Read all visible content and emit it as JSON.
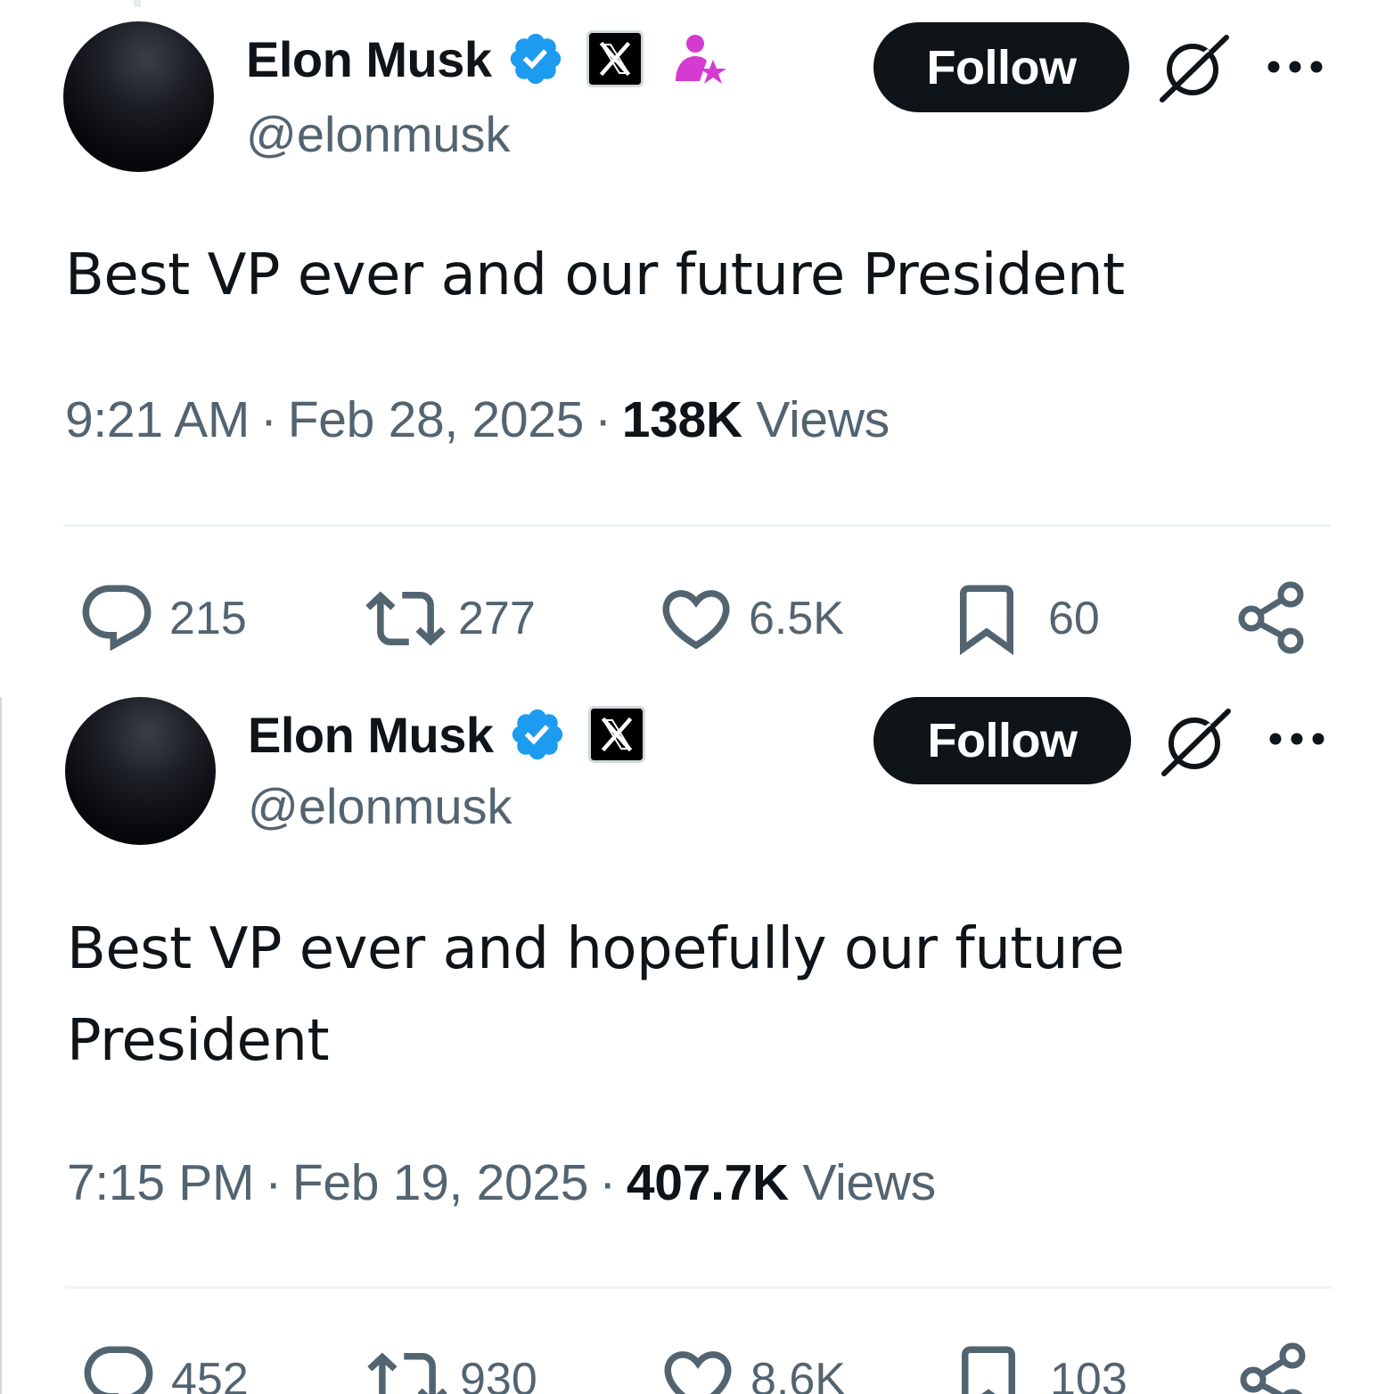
{
  "colors": {
    "text_primary": "#0f1419",
    "text_secondary": "#536471",
    "verified_blue": "#1d9bf0",
    "subscriber_magenta": "#d53bd0",
    "follow_button_bg": "#0f1419"
  },
  "tweets": [
    {
      "author": {
        "display_name": "Elon Musk",
        "handle": "@elonmusk",
        "badges": [
          "verified-icon",
          "x-affiliate-icon",
          "subscriber-icon"
        ]
      },
      "follow_label": "Follow",
      "text": "Best VP ever and our future President",
      "time": "9:21 AM",
      "separator": "·",
      "date": "Feb 28, 2025",
      "views_count": "138K",
      "views_label": "Views",
      "stats": {
        "replies": "215",
        "retweets": "277",
        "likes": "6.5K",
        "bookmarks": "60"
      }
    },
    {
      "author": {
        "display_name": "Elon Musk",
        "handle": "@elonmusk",
        "badges": [
          "verified-icon",
          "x-affiliate-icon"
        ]
      },
      "follow_label": "Follow",
      "text": "Best VP ever and hopefully our future President",
      "time": "7:15 PM",
      "separator": "·",
      "date": "Feb 19, 2025",
      "views_count": "407.7K",
      "views_label": "Views",
      "stats": {
        "replies": "452",
        "retweets": "930",
        "likes": "8.6K",
        "bookmarks": "103"
      }
    }
  ]
}
